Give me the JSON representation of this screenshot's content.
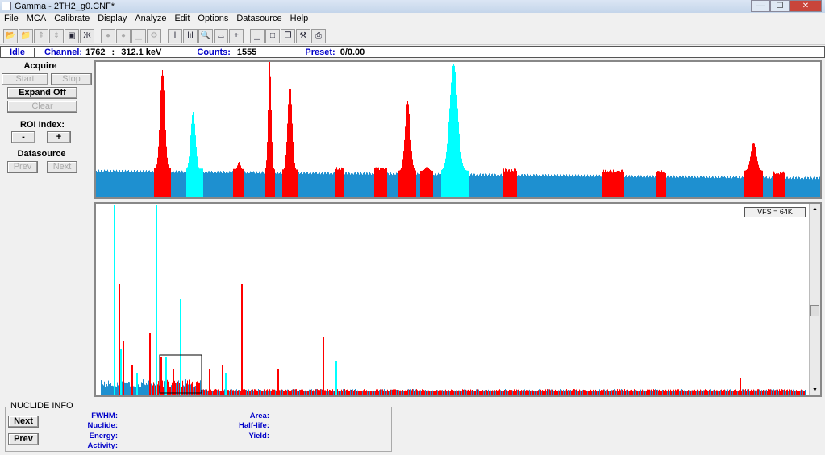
{
  "window": {
    "title": "Gamma - 2TH2_g0.CNF*",
    "min": "—",
    "max": "☐",
    "close": "✕"
  },
  "menu": [
    "File",
    "MCA",
    "Calibrate",
    "Display",
    "Analyze",
    "Edit",
    "Options",
    "Datasource",
    "Help"
  ],
  "toolbar": [
    {
      "icon": "open-folder-icon",
      "glyph": "📂",
      "enabled": true
    },
    {
      "icon": "open-datasource-icon",
      "glyph": "📁",
      "enabled": true
    },
    {
      "icon": "move-up-icon",
      "glyph": "⇞",
      "enabled": false
    },
    {
      "icon": "move-down-icon",
      "glyph": "⇟",
      "enabled": false
    },
    {
      "icon": "save-icon",
      "glyph": "▣",
      "enabled": true
    },
    {
      "icon": "report-icon",
      "glyph": "Ж",
      "enabled": true
    },
    {
      "sep": true
    },
    {
      "icon": "start-acquire-icon",
      "glyph": "●",
      "enabled": false
    },
    {
      "icon": "stop-acquire-icon",
      "glyph": "●",
      "enabled": false
    },
    {
      "icon": "clear-icon",
      "glyph": "▁",
      "enabled": false
    },
    {
      "icon": "adjust-icon",
      "glyph": "⚙",
      "enabled": false
    },
    {
      "sep": true
    },
    {
      "icon": "linear-scale-icon",
      "glyph": "ılı",
      "enabled": true
    },
    {
      "icon": "log-scale-icon",
      "glyph": "lıl",
      "enabled": true
    },
    {
      "icon": "zoom-icon",
      "glyph": "🔍",
      "enabled": true
    },
    {
      "icon": "compare-icon",
      "glyph": "⌓",
      "enabled": true
    },
    {
      "icon": "crosshair-icon",
      "glyph": "+",
      "enabled": true
    },
    {
      "sep": true
    },
    {
      "icon": "minimize-icon",
      "glyph": "▁",
      "enabled": true
    },
    {
      "icon": "maximize-icon",
      "glyph": "□",
      "enabled": true
    },
    {
      "icon": "restore-icon",
      "glyph": "❐",
      "enabled": true
    },
    {
      "icon": "tools-icon",
      "glyph": "⚒",
      "enabled": true
    },
    {
      "icon": "print-icon",
      "glyph": "⎙",
      "enabled": true
    }
  ],
  "status": {
    "state": "Idle",
    "channel_label": "Channel:",
    "channel": "1762",
    "sep": ":",
    "energy": "312.1 keV",
    "counts_label": "Counts:",
    "counts": "1555",
    "preset_label": "Preset:",
    "preset": "0/0.00"
  },
  "left": {
    "acquire": "Acquire",
    "start": "Start",
    "stop": "Stop",
    "expand": "Expand Off",
    "clear": "Clear",
    "roi_index": "ROI Index:",
    "minus": "-",
    "plus": "+",
    "datasource": "Datasource",
    "prev": "Prev",
    "next": "Next"
  },
  "spectrum": {
    "vfs": "VFS = 64K",
    "colors": {
      "background": "#1e90d0",
      "roi": "#ff0000",
      "roi_selected": "#00ffff"
    }
  },
  "nuclide": {
    "title": "NUCLIDE INFO",
    "next": "Next",
    "prev": "Prev",
    "fwhm": "FWHM:",
    "nuclide": "Nuclide:",
    "energy": "Energy:",
    "activity": "Activity:",
    "area": "Area:",
    "half_life": "Half-life:",
    "yield": "Yield:"
  }
}
